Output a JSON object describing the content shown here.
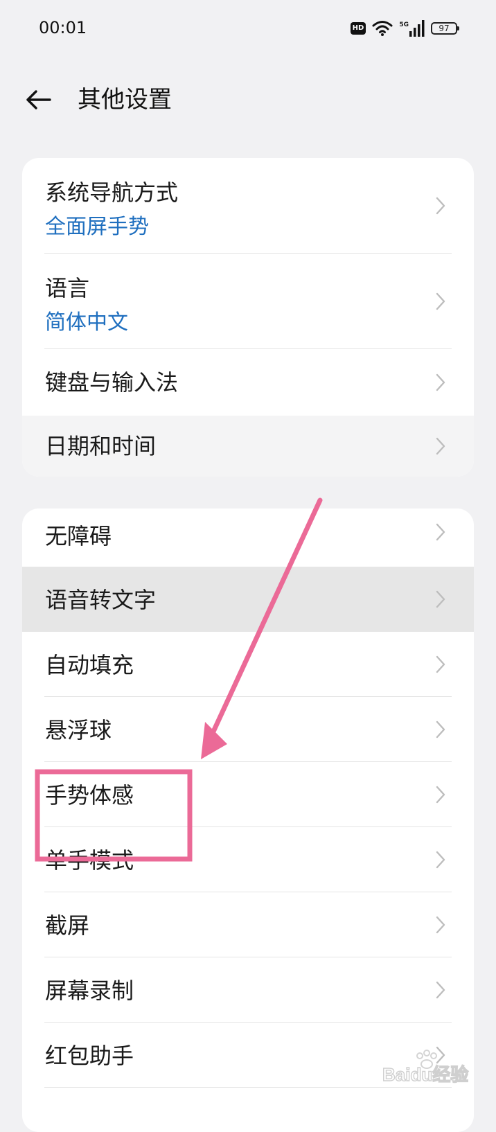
{
  "status_bar": {
    "time": "00:01",
    "hd_badge": "HD",
    "network_label": "5G",
    "battery_level": "97",
    "icons": [
      "hd-icon",
      "wifi-icon",
      "cellular-signal-icon",
      "battery-icon"
    ]
  },
  "header": {
    "title": "其他设置",
    "back_icon": "arrow-left-icon"
  },
  "group1": [
    {
      "title": "系统导航方式",
      "subtitle": "全面屏手势"
    },
    {
      "title": "语言",
      "subtitle": "简体中文"
    },
    {
      "title": "键盘与输入法"
    },
    {
      "title": "日期和时间"
    }
  ],
  "group2": [
    {
      "title": "无障碍"
    },
    {
      "title": "语音转文字"
    },
    {
      "title": "自动填充"
    },
    {
      "title": "悬浮球"
    },
    {
      "title": "手势体感"
    },
    {
      "title": "单手模式"
    },
    {
      "title": "截屏"
    },
    {
      "title": "屏幕录制"
    },
    {
      "title": "红包助手"
    }
  ],
  "annotation": {
    "color": "#eb6a97",
    "highlighted_item": "手势体感"
  },
  "watermark": {
    "text": "Baidu经验"
  },
  "colors": {
    "background": "#f1f1f3",
    "card": "#ffffff",
    "subtitle_accent": "#1f6fbf",
    "pressed_row": "#e6e6e6"
  }
}
